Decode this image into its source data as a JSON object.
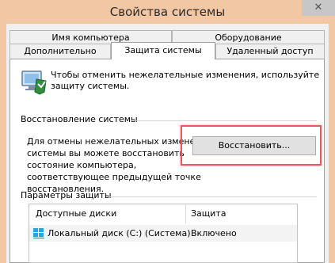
{
  "window": {
    "title": "Свойства системы",
    "close_glyph": "✕"
  },
  "tabs": {
    "row1": [
      "Имя компьютера",
      "Оборудование"
    ],
    "row2": [
      "Дополнительно",
      "Защита системы",
      "Удаленный доступ"
    ],
    "active": "Защита системы"
  },
  "intro": {
    "icon": "shield-icon",
    "line1": "Чтобы отменить нежелательные изменения, используйте",
    "line2": "защиту системы."
  },
  "restore": {
    "section_title": "Восстановление системы",
    "lines": [
      "Для отмены нежелательных изменений",
      "системы вы можете восстановить",
      "состояние компьютера,",
      "соответствующее предыдущей точке",
      "восстановления."
    ],
    "button_label": "Восстановить..."
  },
  "protection": {
    "section_title": "Параметры защиты",
    "columns": [
      "Доступные диски",
      "Защита"
    ],
    "rows": [
      {
        "drive": "Локальный диск (C:) (Система)",
        "status": "Включено",
        "icon": "drive-icon"
      }
    ]
  },
  "colors": {
    "title_bar": "#f2c8a4",
    "highlight": "#e8585e"
  }
}
